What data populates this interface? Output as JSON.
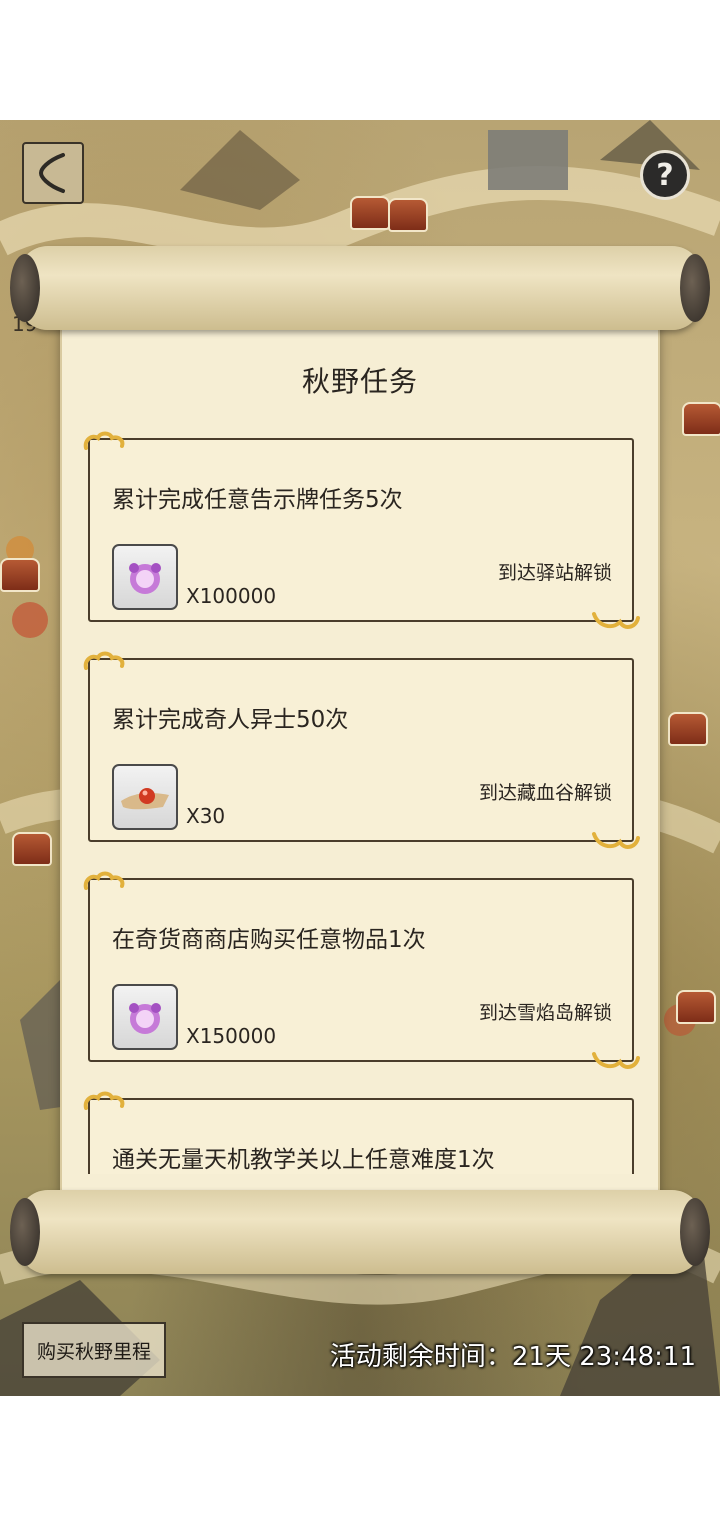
{
  "header": {
    "help_symbol": "?"
  },
  "map": {
    "marker_count": "19"
  },
  "scroll": {
    "title": "秋野任务",
    "tasks": [
      {
        "description": "累计完成任意告示牌任务5次",
        "reward_icon": "purple-orb-icon",
        "reward_count": "X100000",
        "unlock": "到达驿站解锁"
      },
      {
        "description": "累计完成奇人异士50次",
        "reward_icon": "red-bead-cloth-icon",
        "reward_count": "X30",
        "unlock": "到达藏血谷解锁"
      },
      {
        "description": "在奇货商商店购买任意物品1次",
        "reward_icon": "purple-orb-icon",
        "reward_count": "X150000",
        "unlock": "到达雪焰岛解锁"
      },
      {
        "description": "通关无量天机教学关以上任意难度1次"
      }
    ]
  },
  "footer": {
    "buy_label": "购买秋野里程",
    "timer_label": "活动剩余时间：",
    "timer_value": "21天 23:48:11"
  },
  "colors": {
    "paper": "#f6eed4",
    "ink": "#2a2520",
    "cloud_gold": "#e2b13c"
  }
}
